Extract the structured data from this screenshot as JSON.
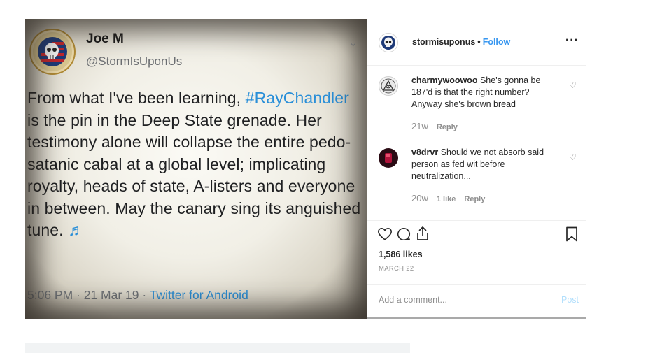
{
  "tweet": {
    "name": "Joe M",
    "handle": "@StormIsUponUs",
    "text_before": "From what I've been learning, ",
    "hashtag": "#RayChandler",
    "text_after": " is the pin in the Deep State grenade. Her testimony alone will collapse the entire pedo-satanic cabal at a global level; implicating royalty, heads of state, A-listers and everyone in between. May the canary sing its anguished tune. ",
    "music_glyph": "♬",
    "time": "5:06 PM · 21 Mar 19 · ",
    "source": "Twitter for Android",
    "avatar_text_top": "MADE IN THE USA",
    "avatar_text_bottom": "MADE IN THE USA"
  },
  "instagram": {
    "username": "stormisuponus",
    "dot": "•",
    "follow_label": "Follow",
    "more_label": "···",
    "comments": [
      {
        "user": "charmywoowoo",
        "text": "She's gonna be 187'd is that the right number? Anyway she's brown bread",
        "time": "21w",
        "likes": "",
        "reply": "Reply"
      },
      {
        "user": "v8drvr",
        "text": "Should we not absorb said person as fed wit before neutralization...",
        "time": "20w",
        "likes": "1 like",
        "reply": "Reply"
      }
    ],
    "likes": "1,586 likes",
    "date": "MARCH 22",
    "add_comment_placeholder": "Add a comment...",
    "post_label": "Post"
  },
  "icons": {
    "heart": "heart-icon",
    "comment": "comment-icon",
    "share": "share-icon",
    "bookmark": "bookmark-icon"
  },
  "colors": {
    "twitter_blue": "#2a8fd8",
    "instagram_blue": "#3897f0",
    "muted": "#8e8e8e"
  }
}
